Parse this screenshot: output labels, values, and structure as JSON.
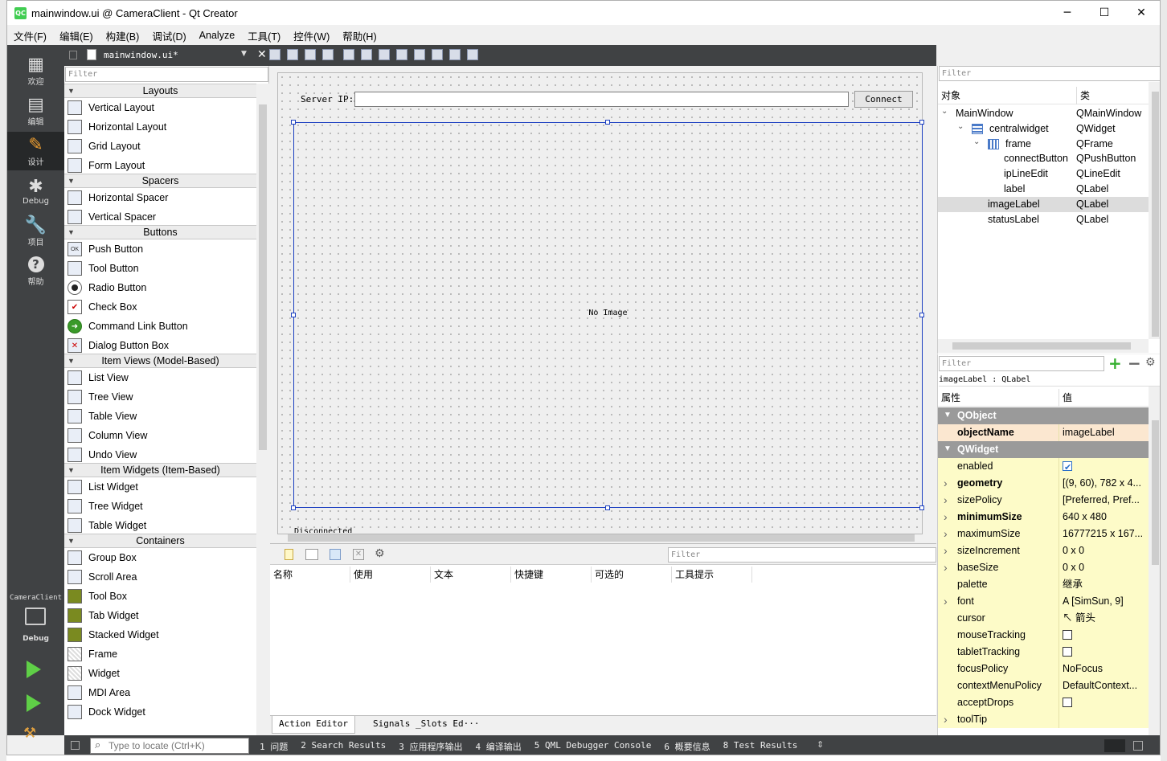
{
  "window": {
    "title": "mainwindow.ui @ CameraClient - Qt Creator",
    "logo": "QC"
  },
  "menu": [
    "文件(F)",
    "编辑(E)",
    "构建(B)",
    "调试(D)",
    "Analyze",
    "工具(T)",
    "控件(W)",
    "帮助(H)"
  ],
  "modes": [
    {
      "label": "欢迎",
      "icon": "grid-icon"
    },
    {
      "label": "编辑",
      "icon": "document-icon"
    },
    {
      "label": "设计",
      "icon": "pencil-icon",
      "active": true
    },
    {
      "label": "Debug",
      "icon": "bug-icon"
    },
    {
      "label": "项目",
      "icon": "wrench-icon"
    },
    {
      "label": "帮助",
      "icon": "help-icon"
    }
  ],
  "kit": {
    "project": "CameraClient",
    "config": "Debug"
  },
  "document": {
    "name": "mainwindow.ui*"
  },
  "widgetbox": {
    "filter_placeholder": "Filter",
    "categories": [
      {
        "name": "Layouts",
        "items": [
          "Vertical Layout",
          "Horizontal Layout",
          "Grid Layout",
          "Form Layout"
        ]
      },
      {
        "name": "Spacers",
        "items": [
          "Horizontal Spacer",
          "Vertical Spacer"
        ]
      },
      {
        "name": "Buttons",
        "items": [
          "Push Button",
          "Tool Button",
          "Radio Button",
          "Check Box",
          "Command Link Button",
          "Dialog Button Box"
        ]
      },
      {
        "name": "Item Views (Model-Based)",
        "items": [
          "List View",
          "Tree View",
          "Table View",
          "Column View",
          "Undo View"
        ]
      },
      {
        "name": "Item Widgets (Item-Based)",
        "items": [
          "List Widget",
          "Tree Widget",
          "Table Widget"
        ]
      },
      {
        "name": "Containers",
        "items": [
          "Group Box",
          "Scroll Area",
          "Tool Box",
          "Tab Widget",
          "Stacked Widget",
          "Frame",
          "Widget",
          "MDI Area",
          "Dock Widget"
        ]
      }
    ]
  },
  "form": {
    "server_ip_label": "Server IP:",
    "ip_value": "",
    "connect_label": "Connect",
    "image_text": "No Image",
    "status_partial": "Disconnected"
  },
  "action_editor": {
    "filter_placeholder": "Filter",
    "columns": [
      "名称",
      "使用",
      "文本",
      "快捷键",
      "可选的",
      "工具提示"
    ],
    "tabs": [
      "Action Editor",
      "Signals _Slots Ed···"
    ]
  },
  "object_inspector": {
    "filter_placeholder": "Filter",
    "col_object": "对象",
    "col_class": "类",
    "rows": [
      {
        "name": "MainWindow",
        "cls": "QMainWindow",
        "indent": 0,
        "exp": "v"
      },
      {
        "name": "centralwidget",
        "cls": "QWidget",
        "indent": 1,
        "exp": "v"
      },
      {
        "name": "frame",
        "cls": "QFrame",
        "indent": 2,
        "exp": "v"
      },
      {
        "name": "connectButton",
        "cls": "QPushButton",
        "indent": 3,
        "exp": ""
      },
      {
        "name": "ipLineEdit",
        "cls": "QLineEdit",
        "indent": 3,
        "exp": ""
      },
      {
        "name": "label",
        "cls": "QLabel",
        "indent": 3,
        "exp": ""
      },
      {
        "name": "imageLabel",
        "cls": "QLabel",
        "indent": 1,
        "exp": "",
        "selected": true
      },
      {
        "name": "statusLabel",
        "cls": "QLabel",
        "indent": 1,
        "exp": ""
      }
    ]
  },
  "property_editor": {
    "filter_placeholder": "Filter",
    "context": "imageLabel : QLabel",
    "col_prop": "属性",
    "col_value": "值",
    "rows": [
      {
        "name": "QObject",
        "value": "",
        "group": true
      },
      {
        "name": "objectName",
        "value": "imageLabel",
        "bold": true,
        "hl": true
      },
      {
        "name": "QWidget",
        "value": "",
        "group": true
      },
      {
        "name": "enabled",
        "value": "",
        "check": "on"
      },
      {
        "name": "geometry",
        "value": "[(9, 60), 782 x 4...",
        "bold": true,
        "exp": true
      },
      {
        "name": "sizePolicy",
        "value": "[Preferred, Pref...",
        "exp": true
      },
      {
        "name": "minimumSize",
        "value": "640 x 480",
        "bold": true,
        "exp": true
      },
      {
        "name": "maximumSize",
        "value": "16777215 x 167...",
        "exp": true
      },
      {
        "name": "sizeIncrement",
        "value": "0 x 0",
        "exp": true
      },
      {
        "name": "baseSize",
        "value": "0 x 0",
        "exp": true
      },
      {
        "name": "palette",
        "value": "继承"
      },
      {
        "name": "font",
        "value": "A  [SimSun, 9]",
        "exp": true
      },
      {
        "name": "cursor",
        "value": "↖  箭头"
      },
      {
        "name": "mouseTracking",
        "value": "",
        "check": "off"
      },
      {
        "name": "tabletTracking",
        "value": "",
        "check": "off"
      },
      {
        "name": "focusPolicy",
        "value": "NoFocus"
      },
      {
        "name": "contextMenuPolicy",
        "value": "DefaultContext..."
      },
      {
        "name": "acceptDrops",
        "value": "",
        "check": "off"
      },
      {
        "name": "toolTip",
        "value": "",
        "exp": true
      }
    ]
  },
  "statusbar": {
    "locator_placeholder": "Type to locate (Ctrl+K)",
    "tabs": [
      "1 问题",
      "2 Search Results",
      "3 应用程序输出",
      "4 编译输出",
      "5 QML Debugger Console",
      "6 概要信息",
      "8 Test Results"
    ]
  },
  "colors": {
    "accent": "#41cd52",
    "sidebar": "#404244",
    "property_bg": "#fdfbc8",
    "group_bg": "#9a9a9a",
    "selection": "#1b3fc0"
  }
}
